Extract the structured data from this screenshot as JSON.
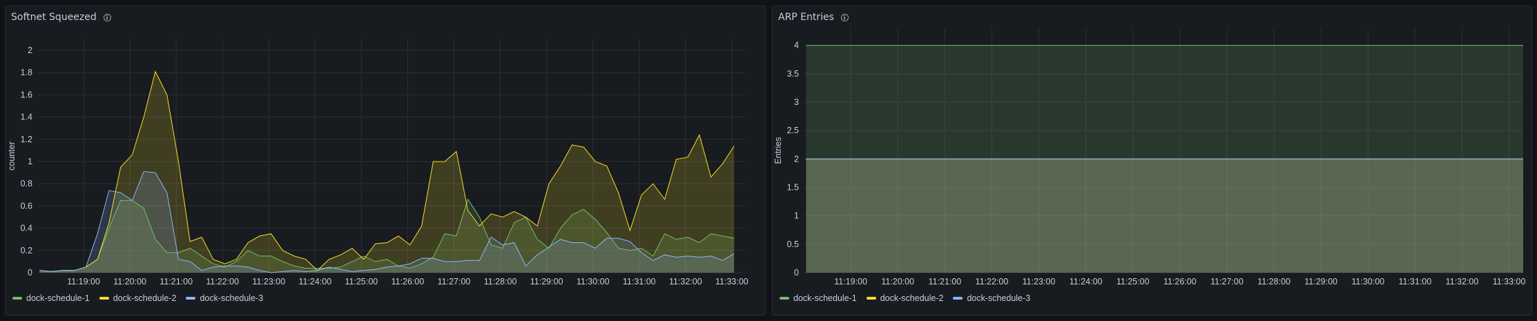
{
  "chart_data": [
    {
      "type": "area",
      "title": "Softnet Squeezed",
      "ylabel": "counter",
      "xlabel": "",
      "ylim": [
        0,
        2
      ],
      "yticks": [
        0,
        0.2,
        0.4,
        0.6,
        0.8,
        1,
        1.2,
        1.4,
        1.6,
        1.8,
        2
      ],
      "x_labels": [
        "11:19:00",
        "11:20:00",
        "11:21:00",
        "11:22:00",
        "11:23:00",
        "11:24:00",
        "11:25:00",
        "11:26:00",
        "11:27:00",
        "11:28:00",
        "11:29:00",
        "11:30:00",
        "11:31:00",
        "11:32:00",
        "11:33:00"
      ],
      "x_tick_minutes": [
        19,
        20,
        21,
        22,
        23,
        24,
        25,
        26,
        27,
        28,
        29,
        30,
        31,
        32,
        33
      ],
      "xlim_minutes": [
        18.0,
        33.3
      ],
      "grid": true,
      "legend_position": "bottom-left",
      "series": [
        {
          "name": "dock-schedule-1",
          "color": "#73bf69",
          "points": [
            [
              18.05,
              0.02
            ],
            [
              18.3,
              0.01
            ],
            [
              18.55,
              0.02
            ],
            [
              18.8,
              0.02
            ],
            [
              19.05,
              0.05
            ],
            [
              19.3,
              0.12
            ],
            [
              19.55,
              0.4
            ],
            [
              19.8,
              0.65
            ],
            [
              20.05,
              0.65
            ],
            [
              20.3,
              0.58
            ],
            [
              20.55,
              0.3
            ],
            [
              20.8,
              0.18
            ],
            [
              21.05,
              0.18
            ],
            [
              21.3,
              0.22
            ],
            [
              21.55,
              0.15
            ],
            [
              21.8,
              0.08
            ],
            [
              22.05,
              0.05
            ],
            [
              22.3,
              0.1
            ],
            [
              22.55,
              0.2
            ],
            [
              22.8,
              0.15
            ],
            [
              23.05,
              0.15
            ],
            [
              23.3,
              0.1
            ],
            [
              23.55,
              0.06
            ],
            [
              23.8,
              0.04
            ],
            [
              24.05,
              0.04
            ],
            [
              24.3,
              0.04
            ],
            [
              24.55,
              0.05
            ],
            [
              24.8,
              0.1
            ],
            [
              25.05,
              0.15
            ],
            [
              25.3,
              0.1
            ],
            [
              25.55,
              0.12
            ],
            [
              25.8,
              0.06
            ],
            [
              26.05,
              0.04
            ],
            [
              26.3,
              0.08
            ],
            [
              26.55,
              0.14
            ],
            [
              26.8,
              0.35
            ],
            [
              27.05,
              0.33
            ],
            [
              27.3,
              0.66
            ],
            [
              27.55,
              0.5
            ],
            [
              27.8,
              0.25
            ],
            [
              28.05,
              0.22
            ],
            [
              28.3,
              0.45
            ],
            [
              28.55,
              0.5
            ],
            [
              28.8,
              0.3
            ],
            [
              29.05,
              0.22
            ],
            [
              29.3,
              0.4
            ],
            [
              29.55,
              0.52
            ],
            [
              29.8,
              0.57
            ],
            [
              30.05,
              0.48
            ],
            [
              30.3,
              0.36
            ],
            [
              30.55,
              0.22
            ],
            [
              30.8,
              0.2
            ],
            [
              31.05,
              0.22
            ],
            [
              31.3,
              0.15
            ],
            [
              31.55,
              0.35
            ],
            [
              31.8,
              0.3
            ],
            [
              32.05,
              0.32
            ],
            [
              32.3,
              0.27
            ],
            [
              32.55,
              0.35
            ],
            [
              32.8,
              0.33
            ],
            [
              33.05,
              0.31
            ]
          ]
        },
        {
          "name": "dock-schedule-2",
          "color": "#fade2a",
          "points": [
            [
              18.05,
              0.02
            ],
            [
              18.3,
              0.01
            ],
            [
              18.55,
              0.02
            ],
            [
              18.8,
              0.02
            ],
            [
              19.05,
              0.05
            ],
            [
              19.3,
              0.12
            ],
            [
              19.55,
              0.45
            ],
            [
              19.8,
              0.95
            ],
            [
              20.05,
              1.06
            ],
            [
              20.3,
              1.4
            ],
            [
              20.55,
              1.81
            ],
            [
              20.8,
              1.6
            ],
            [
              21.05,
              1.0
            ],
            [
              21.3,
              0.28
            ],
            [
              21.55,
              0.32
            ],
            [
              21.8,
              0.12
            ],
            [
              22.05,
              0.08
            ],
            [
              22.3,
              0.12
            ],
            [
              22.55,
              0.27
            ],
            [
              22.8,
              0.33
            ],
            [
              23.05,
              0.35
            ],
            [
              23.3,
              0.2
            ],
            [
              23.55,
              0.15
            ],
            [
              23.8,
              0.12
            ],
            [
              24.05,
              0.02
            ],
            [
              24.3,
              0.12
            ],
            [
              24.55,
              0.16
            ],
            [
              24.8,
              0.22
            ],
            [
              25.05,
              0.12
            ],
            [
              25.3,
              0.26
            ],
            [
              25.55,
              0.27
            ],
            [
              25.8,
              0.33
            ],
            [
              26.05,
              0.25
            ],
            [
              26.3,
              0.42
            ],
            [
              26.55,
              1.0
            ],
            [
              26.8,
              1.0
            ],
            [
              27.05,
              1.09
            ],
            [
              27.3,
              0.56
            ],
            [
              27.55,
              0.42
            ],
            [
              27.8,
              0.53
            ],
            [
              28.05,
              0.5
            ],
            [
              28.3,
              0.55
            ],
            [
              28.55,
              0.5
            ],
            [
              28.8,
              0.42
            ],
            [
              29.05,
              0.8
            ],
            [
              29.3,
              0.96
            ],
            [
              29.55,
              1.15
            ],
            [
              29.8,
              1.13
            ],
            [
              30.05,
              1.0
            ],
            [
              30.3,
              0.96
            ],
            [
              30.55,
              0.72
            ],
            [
              30.8,
              0.38
            ],
            [
              31.05,
              0.7
            ],
            [
              31.3,
              0.8
            ],
            [
              31.55,
              0.66
            ],
            [
              31.8,
              1.02
            ],
            [
              32.05,
              1.04
            ],
            [
              32.3,
              1.24
            ],
            [
              32.55,
              0.86
            ],
            [
              32.8,
              0.98
            ],
            [
              33.05,
              1.14
            ]
          ]
        },
        {
          "name": "dock-schedule-3",
          "color": "#8ab8ff",
          "points": [
            [
              18.05,
              0.02
            ],
            [
              18.3,
              0.01
            ],
            [
              18.55,
              0.02
            ],
            [
              18.8,
              0.02
            ],
            [
              19.05,
              0.05
            ],
            [
              19.3,
              0.35
            ],
            [
              19.55,
              0.74
            ],
            [
              19.8,
              0.72
            ],
            [
              20.05,
              0.65
            ],
            [
              20.3,
              0.91
            ],
            [
              20.55,
              0.9
            ],
            [
              20.8,
              0.72
            ],
            [
              21.05,
              0.12
            ],
            [
              21.3,
              0.1
            ],
            [
              21.55,
              0.02
            ],
            [
              21.8,
              0.05
            ],
            [
              22.05,
              0.06
            ],
            [
              22.3,
              0.06
            ],
            [
              22.55,
              0.05
            ],
            [
              22.8,
              0.02
            ],
            [
              23.05,
              0.0
            ],
            [
              23.3,
              0.01
            ],
            [
              23.55,
              0.02
            ],
            [
              23.8,
              0.01
            ],
            [
              24.05,
              0.02
            ],
            [
              24.3,
              0.05
            ],
            [
              24.55,
              0.03
            ],
            [
              24.8,
              0.01
            ],
            [
              25.05,
              0.02
            ],
            [
              25.3,
              0.03
            ],
            [
              25.55,
              0.05
            ],
            [
              25.8,
              0.06
            ],
            [
              26.05,
              0.08
            ],
            [
              26.3,
              0.13
            ],
            [
              26.55,
              0.13
            ],
            [
              26.8,
              0.1
            ],
            [
              27.05,
              0.1
            ],
            [
              27.3,
              0.11
            ],
            [
              27.55,
              0.11
            ],
            [
              27.8,
              0.32
            ],
            [
              28.05,
              0.25
            ],
            [
              28.3,
              0.27
            ],
            [
              28.55,
              0.06
            ],
            [
              28.8,
              0.16
            ],
            [
              29.05,
              0.23
            ],
            [
              29.3,
              0.3
            ],
            [
              29.55,
              0.27
            ],
            [
              29.8,
              0.27
            ],
            [
              30.05,
              0.22
            ],
            [
              30.3,
              0.31
            ],
            [
              30.55,
              0.31
            ],
            [
              30.8,
              0.28
            ],
            [
              31.05,
              0.18
            ],
            [
              31.3,
              0.11
            ],
            [
              31.55,
              0.16
            ],
            [
              31.8,
              0.14
            ],
            [
              32.05,
              0.15
            ],
            [
              32.3,
              0.14
            ],
            [
              32.55,
              0.15
            ],
            [
              32.8,
              0.11
            ],
            [
              33.05,
              0.17
            ]
          ]
        }
      ]
    },
    {
      "type": "area",
      "title": "ARP Entries",
      "ylabel": "Entries",
      "xlabel": "",
      "ylim": [
        0,
        4.3
      ],
      "yticks": [
        0,
        0.5,
        1,
        1.5,
        2,
        2.5,
        3,
        3.5,
        4
      ],
      "x_labels": [
        "11:19:00",
        "11:20:00",
        "11:21:00",
        "11:22:00",
        "11:23:00",
        "11:24:00",
        "11:25:00",
        "11:26:00",
        "11:27:00",
        "11:28:00",
        "11:29:00",
        "11:30:00",
        "11:31:00",
        "11:32:00",
        "11:33:00"
      ],
      "x_tick_minutes": [
        19,
        20,
        21,
        22,
        23,
        24,
        25,
        26,
        27,
        28,
        29,
        30,
        31,
        32,
        33
      ],
      "xlim_minutes": [
        18.0,
        33.3
      ],
      "grid": true,
      "legend_position": "bottom-left",
      "series": [
        {
          "name": "dock-schedule-1",
          "color": "#73bf69",
          "points": [
            [
              18.05,
              4
            ],
            [
              33.3,
              4
            ]
          ]
        },
        {
          "name": "dock-schedule-2",
          "color": "#fade2a",
          "points": [
            [
              18.05,
              2
            ],
            [
              33.3,
              2
            ]
          ]
        },
        {
          "name": "dock-schedule-3",
          "color": "#8ab8ff",
          "points": [
            [
              18.05,
              2
            ],
            [
              33.3,
              2
            ]
          ]
        }
      ]
    }
  ]
}
